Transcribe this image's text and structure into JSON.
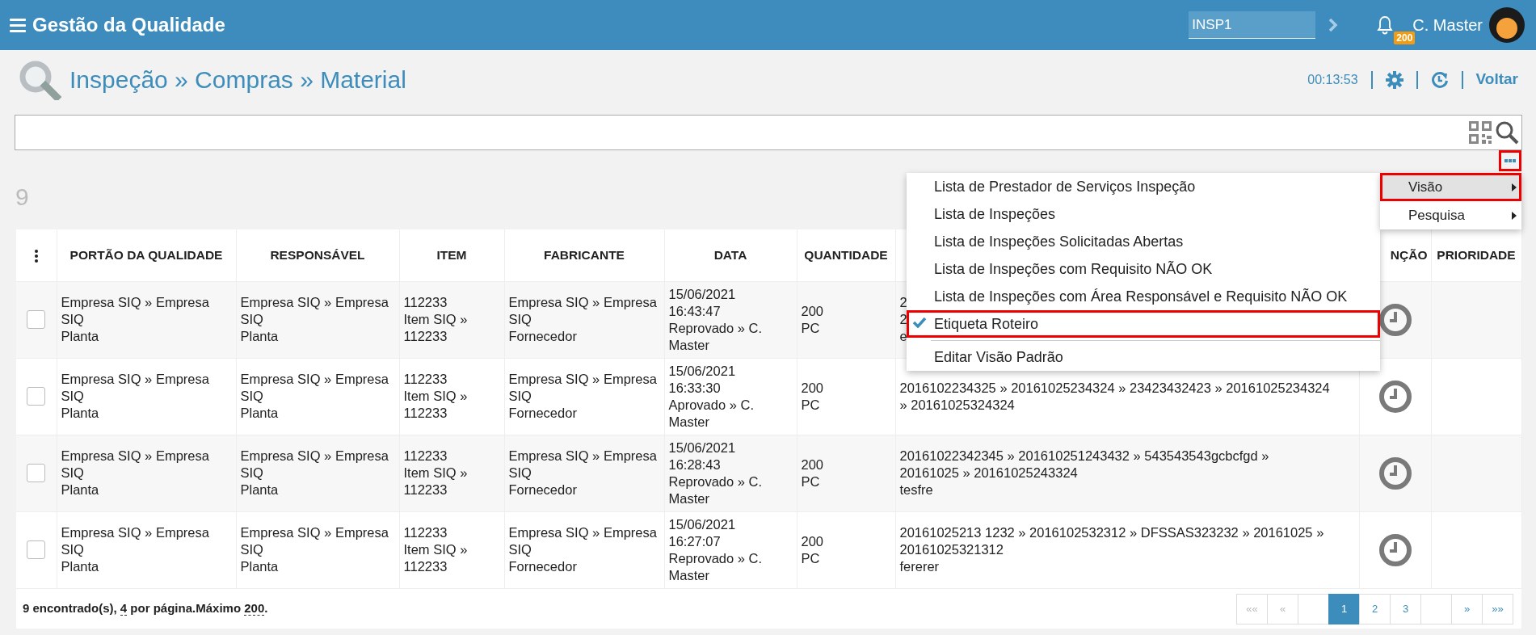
{
  "topbar": {
    "title": "Gestão da Qualidade",
    "station_field": {
      "value": "INSP1"
    },
    "notifications": {
      "badge": "200"
    },
    "user": {
      "name": "C. Master"
    }
  },
  "page_header": {
    "breadcrumb": "Inspeção » Compras » Material",
    "timer": "00:13:53",
    "back_link": "Voltar"
  },
  "more_button": {
    "annotated": true
  },
  "record_count": "9",
  "table": {
    "columns": [
      {
        "kind": "menu"
      },
      {
        "label": "PORTÃO DA QUALIDADE"
      },
      {
        "label": "RESPONSÁVEL"
      },
      {
        "label": "ITEM"
      },
      {
        "label": "FABRICANTE"
      },
      {
        "label": "DATA"
      },
      {
        "label": "QUANTIDADE"
      },
      {
        "kind": "blank"
      },
      {
        "label": "NÇÃO"
      },
      {
        "label": "PRIORIDADE"
      }
    ],
    "rows": [
      {
        "cells": [
          {
            "kind": "checkbox",
            "checked": false
          },
          {
            "kind": "text",
            "lines": [
              "Empresa SIQ » Empresa",
              "SIQ",
              "Planta"
            ]
          },
          {
            "kind": "text",
            "lines": [
              "Empresa SIQ » Empresa",
              "SIQ",
              "Planta"
            ]
          },
          {
            "kind": "text",
            "lines": [
              "112233",
              "Item SIQ »",
              "112233"
            ]
          },
          {
            "kind": "text",
            "lines": [
              "Empresa SIQ » Empresa",
              "SIQ",
              "Fornecedor"
            ]
          },
          {
            "kind": "text",
            "lines": [
              "15/06/2021",
              "16:43:47",
              "Reprovado » C.",
              "Master"
            ]
          },
          {
            "kind": "text",
            "lines": [
              "200",
              "PC"
            ]
          },
          {
            "kind": "text",
            "lines": [
              "2",
              "2",
              "e"
            ]
          },
          {
            "kind": "clock"
          },
          {
            "kind": "empty"
          }
        ]
      },
      {
        "cells": [
          {
            "kind": "checkbox",
            "checked": false
          },
          {
            "kind": "text",
            "lines": [
              "Empresa SIQ » Empresa",
              "SIQ",
              "Planta"
            ]
          },
          {
            "kind": "text",
            "lines": [
              "Empresa SIQ » Empresa",
              "SIQ",
              "Planta"
            ]
          },
          {
            "kind": "text",
            "lines": [
              "112233",
              "Item SIQ »",
              "112233"
            ]
          },
          {
            "kind": "text",
            "lines": [
              "Empresa SIQ » Empresa",
              "SIQ",
              "Fornecedor"
            ]
          },
          {
            "kind": "text",
            "lines": [
              "15/06/2021",
              "16:33:30",
              "Aprovado » C.",
              "Master"
            ]
          },
          {
            "kind": "text",
            "lines": [
              "200",
              "PC"
            ]
          },
          {
            "kind": "text",
            "lines": [
              "2016102234325 » 20161025234324 » 23423432423 » 20161025234324",
              "» 20161025324324"
            ]
          },
          {
            "kind": "clock"
          },
          {
            "kind": "empty"
          }
        ]
      },
      {
        "cells": [
          {
            "kind": "checkbox",
            "checked": false
          },
          {
            "kind": "text",
            "lines": [
              "Empresa SIQ » Empresa",
              "SIQ",
              "Planta"
            ]
          },
          {
            "kind": "text",
            "lines": [
              "Empresa SIQ » Empresa",
              "SIQ",
              "Planta"
            ]
          },
          {
            "kind": "text",
            "lines": [
              "112233",
              "Item SIQ »",
              "112233"
            ]
          },
          {
            "kind": "text",
            "lines": [
              "Empresa SIQ » Empresa",
              "SIQ",
              "Fornecedor"
            ]
          },
          {
            "kind": "text",
            "lines": [
              "15/06/2021",
              "16:28:43",
              "Reprovado » C.",
              "Master"
            ]
          },
          {
            "kind": "text",
            "lines": [
              "200",
              "PC"
            ]
          },
          {
            "kind": "text",
            "lines": [
              "20161022342345 » 201610251243432 » 543543543gcbcfgd »",
              "20161025 » 20161025243324",
              "tesfre"
            ]
          },
          {
            "kind": "clock"
          },
          {
            "kind": "empty"
          }
        ]
      },
      {
        "cells": [
          {
            "kind": "checkbox",
            "checked": false
          },
          {
            "kind": "text",
            "lines": [
              "Empresa SIQ » Empresa",
              "SIQ",
              "Planta"
            ]
          },
          {
            "kind": "text",
            "lines": [
              "Empresa SIQ » Empresa",
              "SIQ",
              "Planta"
            ]
          },
          {
            "kind": "text",
            "lines": [
              "112233",
              "Item SIQ »",
              "112233"
            ]
          },
          {
            "kind": "text",
            "lines": [
              "Empresa SIQ » Empresa",
              "SIQ",
              "Fornecedor"
            ]
          },
          {
            "kind": "text",
            "lines": [
              "15/06/2021",
              "16:27:07",
              "Reprovado » C.",
              "Master"
            ]
          },
          {
            "kind": "text",
            "lines": [
              "200",
              "PC"
            ]
          },
          {
            "kind": "text",
            "lines": [
              "20161025213 1232 » 2016102532312 » DFSSAS323232 » 20161025 »",
              "20161025321312",
              "fererer"
            ]
          },
          {
            "kind": "clock"
          },
          {
            "kind": "empty"
          }
        ]
      }
    ]
  },
  "footer": {
    "parts": [
      {
        "kind": "text",
        "text": "9 encontrado(s), "
      },
      {
        "kind": "link",
        "text": "4"
      },
      {
        "kind": "text",
        "text": " por página.Máximo "
      },
      {
        "kind": "link",
        "text": "200"
      },
      {
        "kind": "text",
        "text": "."
      }
    ]
  },
  "pagination": [
    {
      "kind": "nav",
      "label": "««",
      "disabled": true,
      "selected": false
    },
    {
      "kind": "nav",
      "label": "«",
      "disabled": true,
      "selected": false
    },
    {
      "kind": "blank",
      "selected": false
    },
    {
      "kind": "page",
      "label": "1",
      "disabled": false,
      "selected": true
    },
    {
      "kind": "page",
      "label": "2",
      "disabled": false,
      "selected": false
    },
    {
      "kind": "page",
      "label": "3",
      "disabled": false,
      "selected": false
    },
    {
      "kind": "blank",
      "selected": false
    },
    {
      "kind": "nav",
      "label": "»",
      "disabled": false,
      "selected": false
    },
    {
      "kind": "nav",
      "label": "»»",
      "disabled": false,
      "selected": false
    }
  ],
  "view_menu": {
    "items": [
      {
        "label": "Lista de Prestador de Serviços Inspeção",
        "checked": false,
        "annotated": false
      },
      {
        "label": "Lista de Inspeções",
        "checked": false,
        "annotated": false
      },
      {
        "label": "Lista de Inspeções Solicitadas Abertas",
        "checked": false,
        "annotated": false
      },
      {
        "label": "Lista de Inspeções com Requisito NÃO OK",
        "checked": false,
        "annotated": false
      },
      {
        "label": "Lista de Inspeções com Área Responsável e Requisito NÃO OK",
        "checked": false,
        "annotated": false
      },
      {
        "label": "Etiqueta Roteiro",
        "checked": true,
        "annotated": true
      },
      {
        "label": "Editar Visão Padrão",
        "checked": false,
        "annotated": false,
        "divider_before": true
      }
    ]
  },
  "options_menu": {
    "items": [
      {
        "label": "Visão",
        "selected": true,
        "annotated": true
      },
      {
        "label": "Pesquisa",
        "selected": false,
        "annotated": false
      }
    ]
  }
}
